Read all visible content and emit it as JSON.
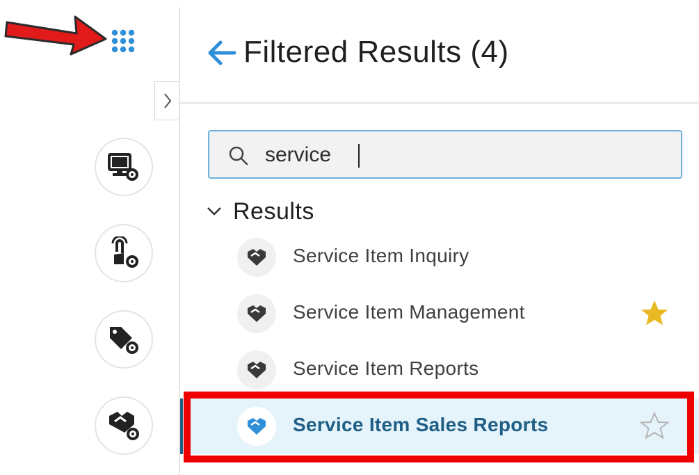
{
  "header": {
    "title": "Filtered Results (4)"
  },
  "search": {
    "value": "service"
  },
  "results": {
    "section_label": "Results",
    "items": [
      {
        "label": "Service Item Inquiry",
        "favorite": false,
        "star_shown": false,
        "selected": false
      },
      {
        "label": "Service Item Management",
        "favorite": true,
        "star_shown": true,
        "selected": false
      },
      {
        "label": "Service Item Reports",
        "favorite": false,
        "star_shown": false,
        "selected": false
      },
      {
        "label": "Service Item Sales Reports",
        "favorite": false,
        "star_shown": true,
        "selected": true
      }
    ]
  },
  "sidebar": {
    "icons": [
      "app-launcher-icon",
      "monitor-settings-icon",
      "touch-settings-icon",
      "tag-settings-icon",
      "handshake-settings-icon"
    ]
  },
  "colors": {
    "accent": "#2f8fd8",
    "selected_text": "#1f5f85",
    "selected_bg": "#e5f3fb",
    "favorite_star": "#e8b923",
    "annotation_red": "#ee0000"
  }
}
